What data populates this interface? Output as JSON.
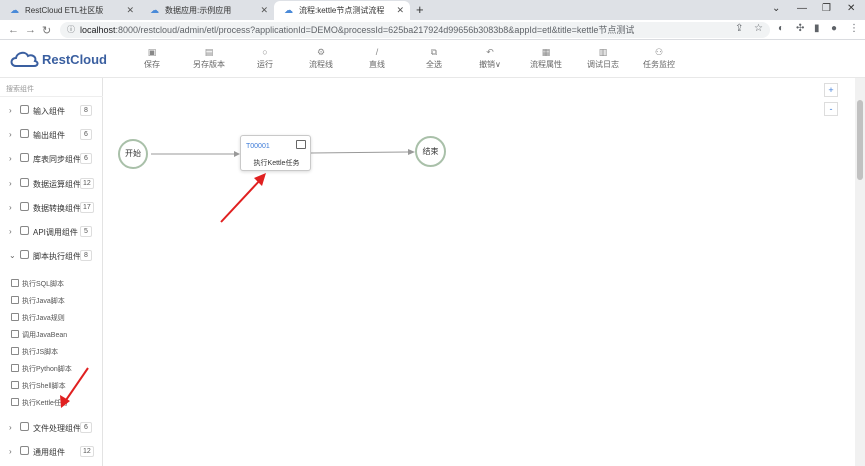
{
  "browser": {
    "tabs": [
      {
        "title": "RestCloud ETL社区版"
      },
      {
        "title": "数据应用:示例应用"
      },
      {
        "title": "流程:kettle节点测试流程"
      }
    ],
    "new_tab": "+",
    "url_host": "localhost",
    "url_rest": ":8000/restcloud/admin/etl/process?applicationId=DEMO&processId=625ba217924d99656b3083b8&appId=etl&title=kettle节点测试"
  },
  "app": {
    "logo_text": "RestCloud",
    "toolbar": [
      {
        "label": "保存",
        "icon": "save-icon"
      },
      {
        "label": "另存版本",
        "icon": "save-as-icon"
      },
      {
        "label": "运行",
        "icon": "run-icon"
      },
      {
        "label": "流程线",
        "icon": "flow-line-icon"
      },
      {
        "label": "直线",
        "icon": "straight-line-icon"
      },
      {
        "label": "全选",
        "icon": "select-all-icon"
      },
      {
        "label": "撤销∨",
        "icon": "undo-icon"
      },
      {
        "label": "流程属性",
        "icon": "properties-icon"
      },
      {
        "label": "调试日志",
        "icon": "log-icon"
      },
      {
        "label": "任务监控",
        "icon": "monitor-icon"
      }
    ]
  },
  "sidebar": {
    "search_placeholder": "搜索组件",
    "groups": [
      {
        "label": "输入组件",
        "count": "8"
      },
      {
        "label": "输出组件",
        "count": "6"
      },
      {
        "label": "库表同步组件",
        "count": "6"
      },
      {
        "label": "数据运算组件",
        "count": "12"
      },
      {
        "label": "数据转换组件",
        "count": "17"
      },
      {
        "label": "API调用组件",
        "count": "5"
      },
      {
        "label": "脚本执行组件",
        "count": "8"
      },
      {
        "label": "文件处理组件",
        "count": "6"
      },
      {
        "label": "通用组件",
        "count": "12"
      }
    ],
    "script_items": [
      {
        "label": "执行SQL脚本"
      },
      {
        "label": "执行Java脚本"
      },
      {
        "label": "执行Java规则"
      },
      {
        "label": "调用JavaBean"
      },
      {
        "label": "执行JS脚本"
      },
      {
        "label": "执行Python脚本"
      },
      {
        "label": "执行Shell脚本"
      },
      {
        "label": "执行Kettle任务"
      }
    ]
  },
  "canvas": {
    "zoom_in": "+",
    "zoom_out": "-",
    "start_node": "开始",
    "end_node": "结束",
    "task_id": "T00001",
    "task_name": "执行Kettle任务"
  },
  "colors": {
    "accent": "#3d7bd8",
    "arrow": "#e02020",
    "node_border": "#a9c0a9"
  }
}
